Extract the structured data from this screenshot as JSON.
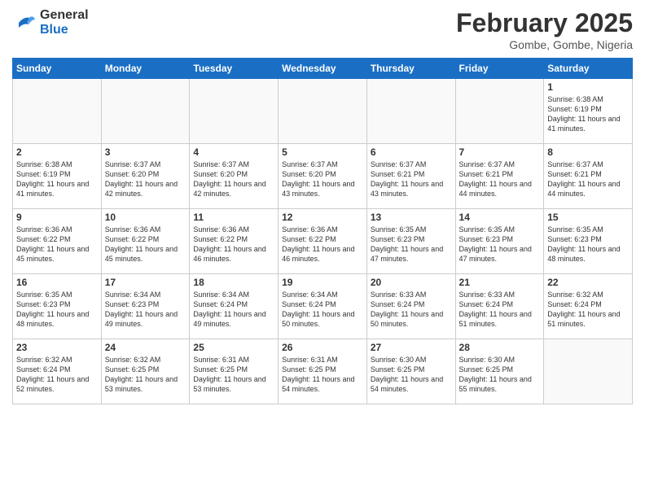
{
  "logo": {
    "general": "General",
    "blue": "Blue"
  },
  "header": {
    "month": "February 2025",
    "location": "Gombe, Gombe, Nigeria"
  },
  "weekdays": [
    "Sunday",
    "Monday",
    "Tuesday",
    "Wednesday",
    "Thursday",
    "Friday",
    "Saturday"
  ],
  "weeks": [
    [
      {
        "day": "",
        "text": ""
      },
      {
        "day": "",
        "text": ""
      },
      {
        "day": "",
        "text": ""
      },
      {
        "day": "",
        "text": ""
      },
      {
        "day": "",
        "text": ""
      },
      {
        "day": "",
        "text": ""
      },
      {
        "day": "1",
        "text": "Sunrise: 6:38 AM\nSunset: 6:19 PM\nDaylight: 11 hours and 41 minutes."
      }
    ],
    [
      {
        "day": "2",
        "text": "Sunrise: 6:38 AM\nSunset: 6:19 PM\nDaylight: 11 hours and 41 minutes."
      },
      {
        "day": "3",
        "text": "Sunrise: 6:37 AM\nSunset: 6:20 PM\nDaylight: 11 hours and 42 minutes."
      },
      {
        "day": "4",
        "text": "Sunrise: 6:37 AM\nSunset: 6:20 PM\nDaylight: 11 hours and 42 minutes."
      },
      {
        "day": "5",
        "text": "Sunrise: 6:37 AM\nSunset: 6:20 PM\nDaylight: 11 hours and 43 minutes."
      },
      {
        "day": "6",
        "text": "Sunrise: 6:37 AM\nSunset: 6:21 PM\nDaylight: 11 hours and 43 minutes."
      },
      {
        "day": "7",
        "text": "Sunrise: 6:37 AM\nSunset: 6:21 PM\nDaylight: 11 hours and 44 minutes."
      },
      {
        "day": "8",
        "text": "Sunrise: 6:37 AM\nSunset: 6:21 PM\nDaylight: 11 hours and 44 minutes."
      }
    ],
    [
      {
        "day": "9",
        "text": "Sunrise: 6:36 AM\nSunset: 6:22 PM\nDaylight: 11 hours and 45 minutes."
      },
      {
        "day": "10",
        "text": "Sunrise: 6:36 AM\nSunset: 6:22 PM\nDaylight: 11 hours and 45 minutes."
      },
      {
        "day": "11",
        "text": "Sunrise: 6:36 AM\nSunset: 6:22 PM\nDaylight: 11 hours and 46 minutes."
      },
      {
        "day": "12",
        "text": "Sunrise: 6:36 AM\nSunset: 6:22 PM\nDaylight: 11 hours and 46 minutes."
      },
      {
        "day": "13",
        "text": "Sunrise: 6:35 AM\nSunset: 6:23 PM\nDaylight: 11 hours and 47 minutes."
      },
      {
        "day": "14",
        "text": "Sunrise: 6:35 AM\nSunset: 6:23 PM\nDaylight: 11 hours and 47 minutes."
      },
      {
        "day": "15",
        "text": "Sunrise: 6:35 AM\nSunset: 6:23 PM\nDaylight: 11 hours and 48 minutes."
      }
    ],
    [
      {
        "day": "16",
        "text": "Sunrise: 6:35 AM\nSunset: 6:23 PM\nDaylight: 11 hours and 48 minutes."
      },
      {
        "day": "17",
        "text": "Sunrise: 6:34 AM\nSunset: 6:23 PM\nDaylight: 11 hours and 49 minutes."
      },
      {
        "day": "18",
        "text": "Sunrise: 6:34 AM\nSunset: 6:24 PM\nDaylight: 11 hours and 49 minutes."
      },
      {
        "day": "19",
        "text": "Sunrise: 6:34 AM\nSunset: 6:24 PM\nDaylight: 11 hours and 50 minutes."
      },
      {
        "day": "20",
        "text": "Sunrise: 6:33 AM\nSunset: 6:24 PM\nDaylight: 11 hours and 50 minutes."
      },
      {
        "day": "21",
        "text": "Sunrise: 6:33 AM\nSunset: 6:24 PM\nDaylight: 11 hours and 51 minutes."
      },
      {
        "day": "22",
        "text": "Sunrise: 6:32 AM\nSunset: 6:24 PM\nDaylight: 11 hours and 51 minutes."
      }
    ],
    [
      {
        "day": "23",
        "text": "Sunrise: 6:32 AM\nSunset: 6:24 PM\nDaylight: 11 hours and 52 minutes."
      },
      {
        "day": "24",
        "text": "Sunrise: 6:32 AM\nSunset: 6:25 PM\nDaylight: 11 hours and 53 minutes."
      },
      {
        "day": "25",
        "text": "Sunrise: 6:31 AM\nSunset: 6:25 PM\nDaylight: 11 hours and 53 minutes."
      },
      {
        "day": "26",
        "text": "Sunrise: 6:31 AM\nSunset: 6:25 PM\nDaylight: 11 hours and 54 minutes."
      },
      {
        "day": "27",
        "text": "Sunrise: 6:30 AM\nSunset: 6:25 PM\nDaylight: 11 hours and 54 minutes."
      },
      {
        "day": "28",
        "text": "Sunrise: 6:30 AM\nSunset: 6:25 PM\nDaylight: 11 hours and 55 minutes."
      },
      {
        "day": "",
        "text": ""
      }
    ]
  ]
}
